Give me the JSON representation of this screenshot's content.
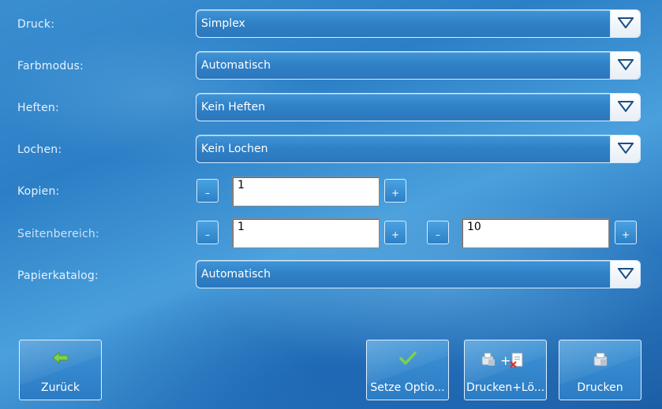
{
  "rows": {
    "druck": {
      "label": "Druck:",
      "value": "Simplex"
    },
    "farbmodus": {
      "label": "Farbmodus:",
      "value": "Automatisch"
    },
    "heften": {
      "label": "Heften:",
      "value": "Kein Heften"
    },
    "lochen": {
      "label": "Lochen:",
      "value": "Kein Lochen"
    },
    "kopien": {
      "label": "Kopien:",
      "value": "1",
      "minus": "–",
      "plus": "+"
    },
    "seitenbereich": {
      "label": "Seitenbereich:",
      "from": "1",
      "to": "10",
      "minus": "–",
      "plus": "+"
    },
    "papierkatalog": {
      "label": "Papierkatalog:",
      "value": "Automatisch"
    }
  },
  "buttons": {
    "back": {
      "label": "Zurück",
      "icon": "arrow-left-icon"
    },
    "set_options": {
      "label": "Setze Optio...",
      "icon": "checkmark-icon"
    },
    "print_delete": {
      "label": "Drucken+Lö...",
      "icon": "print-plus-delete-icon"
    },
    "print": {
      "label": "Drucken",
      "icon": "printer-icon"
    }
  },
  "colors": {
    "accent": "#2f80c6",
    "border": "#d8ecff",
    "check": "#7fd04a",
    "arrow": "#1a4f86"
  }
}
